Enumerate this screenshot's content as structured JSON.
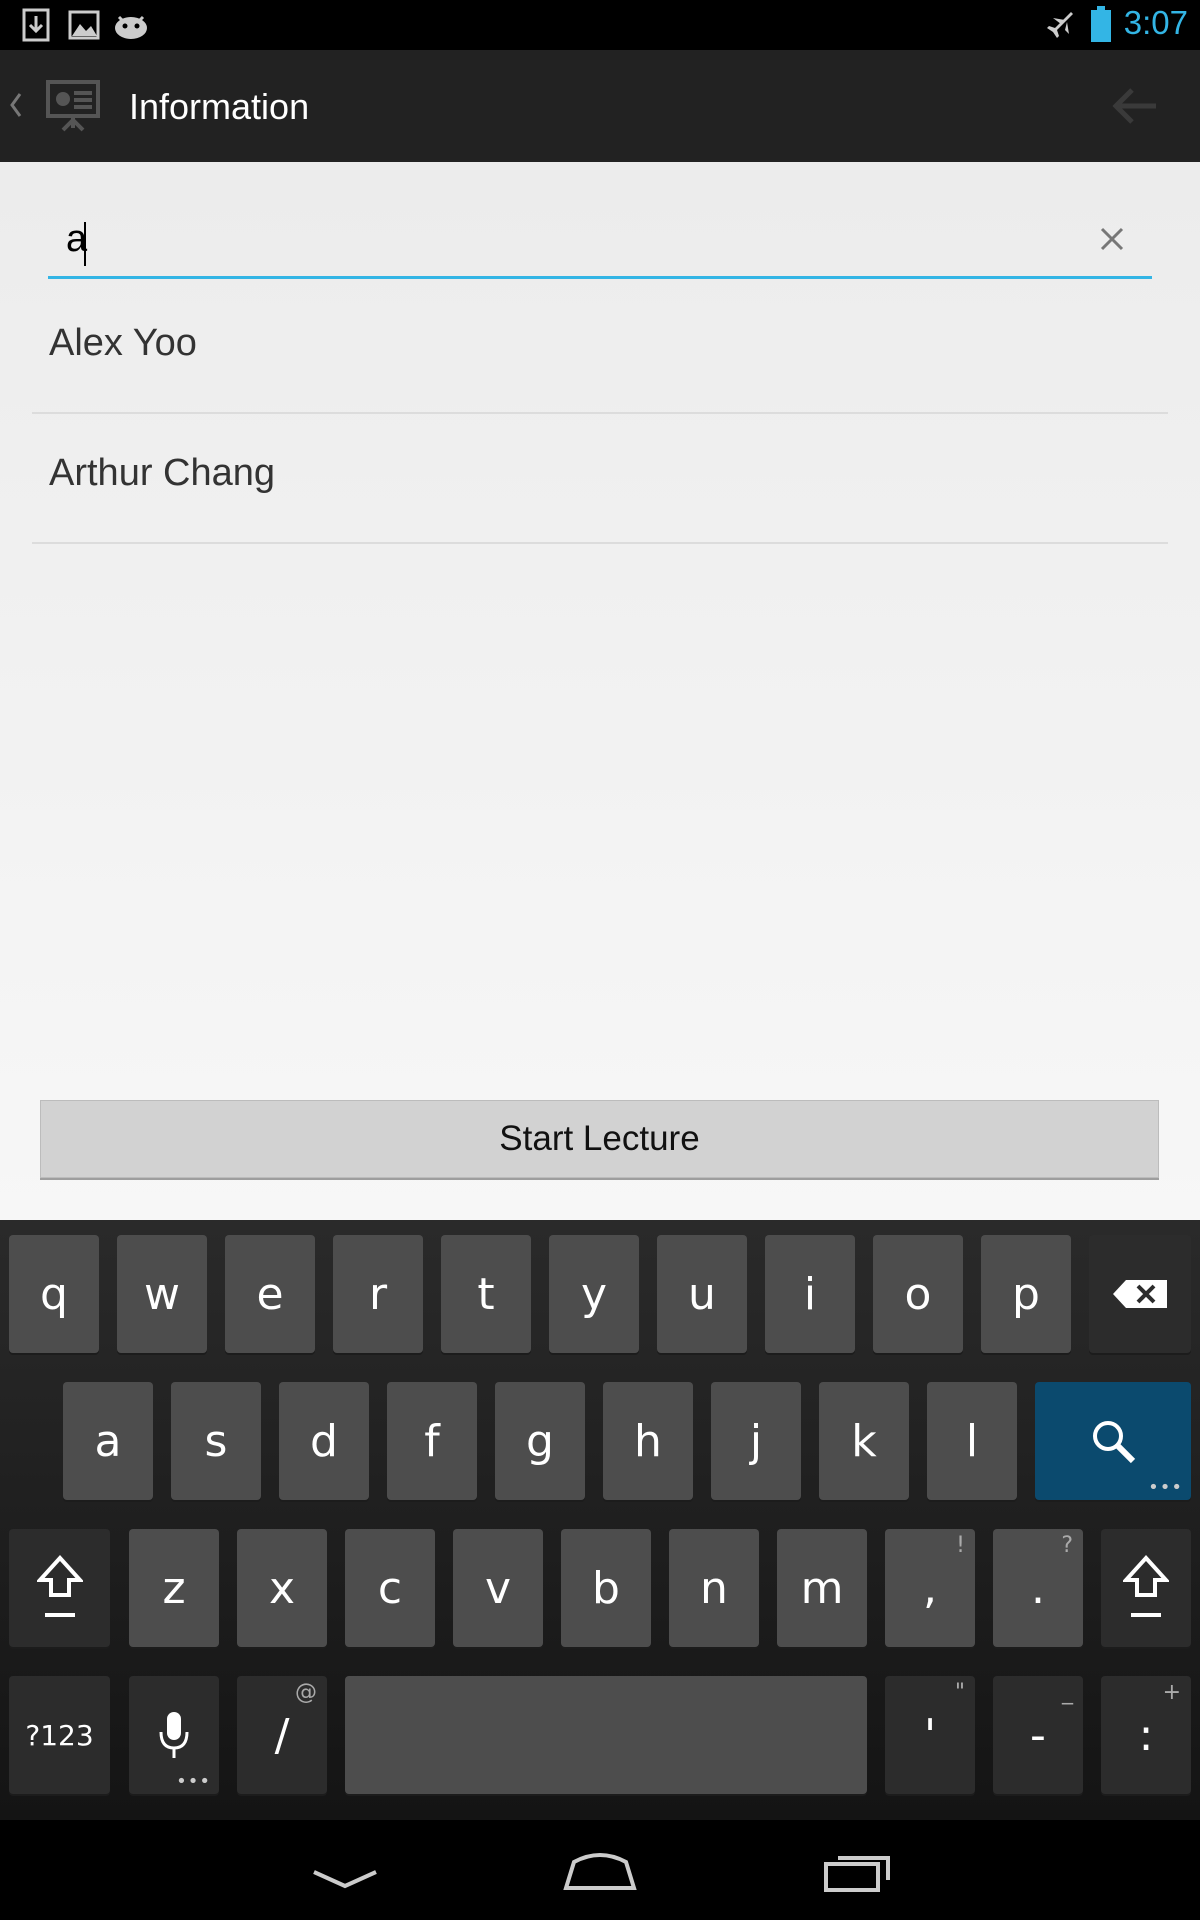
{
  "status_bar": {
    "time": "3:07",
    "left_icons": [
      "download-icon",
      "image-icon",
      "android-icon"
    ],
    "right_icons": [
      "airplane-mode-icon",
      "battery-icon"
    ],
    "accent_color": "#33b5e5"
  },
  "action_bar": {
    "title": "Information",
    "icons": [
      "up-caret-icon",
      "presentation-icon",
      "back-arrow-icon"
    ]
  },
  "search": {
    "value": "a",
    "clear_icon": "clear-icon"
  },
  "results": [
    {
      "name": "Alex Yoo"
    },
    {
      "name": "Arthur Chang"
    }
  ],
  "start_button": {
    "label": "Start Lecture"
  },
  "keyboard": {
    "row1": [
      "q",
      "w",
      "e",
      "r",
      "t",
      "y",
      "u",
      "i",
      "o",
      "p"
    ],
    "row2": [
      "a",
      "s",
      "d",
      "f",
      "g",
      "h",
      "j",
      "k",
      "l"
    ],
    "row3": [
      "z",
      "x",
      "c",
      "v",
      "b",
      "n",
      "m",
      ",",
      "."
    ],
    "row3_hints": {
      "comma": "!",
      "period": "?"
    },
    "row4": {
      "symbols": "?123",
      "slash": "/",
      "slash_hint": "@",
      "apostrophe": "'",
      "apostrophe_hint": "\"",
      "dash": "-",
      "dash_hint": "_",
      "colon": ":",
      "colon_hint": "+"
    },
    "action_key_color": "#0b4a6e"
  },
  "nav_bar": {
    "icons": [
      "back-chevron-icon",
      "home-icon",
      "recent-apps-icon"
    ]
  }
}
